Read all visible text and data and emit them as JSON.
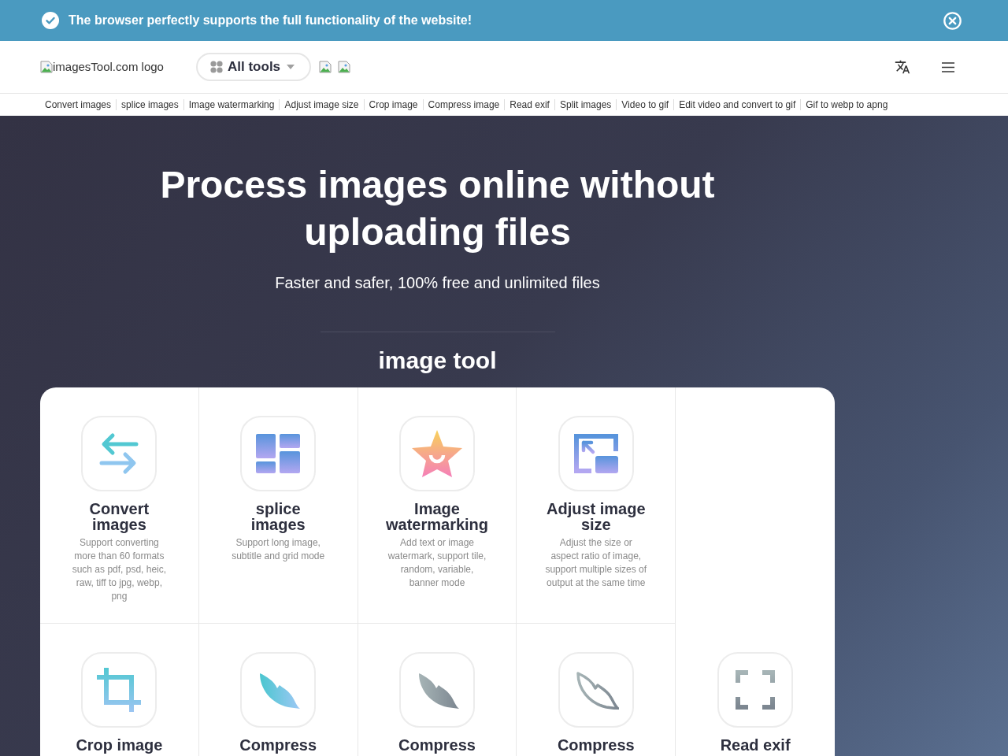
{
  "banner": {
    "message": "The browser perfectly supports the full functionality of the website!"
  },
  "header": {
    "logo_alt": "imagesTool.com logo",
    "all_tools": "All tools"
  },
  "nav_links": [
    "Convert images",
    "splice images",
    "Image watermarking",
    "Adjust image size",
    "Crop image",
    "Compress image",
    "Read exif",
    "Split images",
    "Video to gif",
    "Edit video and convert to gif",
    "Gif to webp to apng"
  ],
  "hero": {
    "title": "Process images online without uploading files",
    "subtitle": "Faster and safer, 100% free and unlimited files",
    "section_title": "image tool"
  },
  "tool_rows": [
    [
      {
        "kind": "convert",
        "title": "Convert images",
        "description": "Support converting more than 60 formats such as pdf, psd, heic, raw, tiff to jpg, webp, png"
      },
      {
        "kind": "splice",
        "title": "splice images",
        "description": "Support long image, subtitle and grid mode"
      },
      {
        "kind": "watermark",
        "title": "Image watermarking",
        "description": "Add text or image watermark, support tile, random, variable, banner mode"
      },
      {
        "kind": "resize",
        "title": "Adjust image size",
        "description": "Adjust the size or aspect ratio of image, support multiple sizes of output at the same time"
      }
    ],
    [
      {
        "kind": "crop",
        "title": "Crop image"
      },
      {
        "kind": "leaf",
        "title": "Compress"
      },
      {
        "kind": "leaf-gray",
        "title": "Compress"
      },
      {
        "kind": "leaf-outline",
        "title": "Compress"
      },
      {
        "kind": "scan",
        "title": "Read exif"
      }
    ]
  ]
}
